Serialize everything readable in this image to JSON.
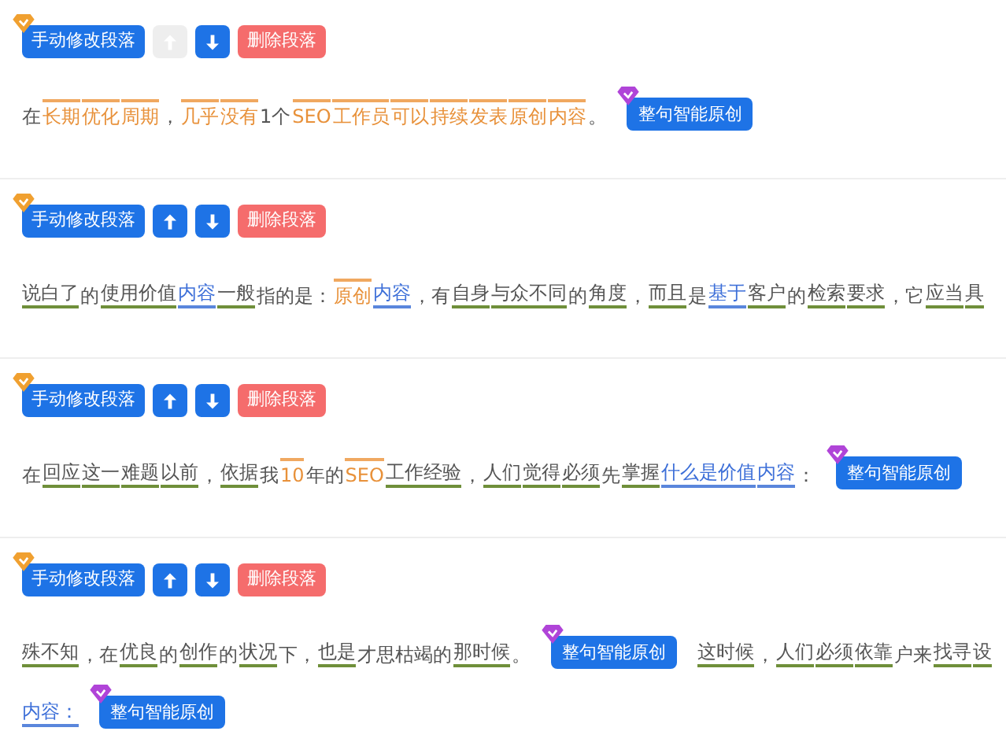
{
  "paragraphs": [
    {
      "toolbar": {
        "edit_label": "手动修改段落",
        "up": {
          "disabled": true
        },
        "down": {
          "disabled": false
        },
        "delete_label": "删除段落"
      },
      "lines": [
        [
          {
            "kind": "plain",
            "text": "在"
          },
          {
            "kind": "original",
            "text": "长期"
          },
          {
            "kind": "original",
            "text": "优化"
          },
          {
            "kind": "original",
            "text": "周期"
          },
          {
            "kind": "plain",
            "text": "，"
          },
          {
            "kind": "original",
            "text": "几乎"
          },
          {
            "kind": "original",
            "text": "没有"
          },
          {
            "kind": "plain",
            "text": "1个"
          },
          {
            "kind": "original",
            "text": "SEO"
          },
          {
            "kind": "original",
            "text": "工作员"
          },
          {
            "kind": "original",
            "text": "可以"
          },
          {
            "kind": "original",
            "text": "持续"
          },
          {
            "kind": "original",
            "text": "发表"
          },
          {
            "kind": "original",
            "text": "原创"
          },
          {
            "kind": "original",
            "text": "内容"
          },
          {
            "kind": "plain",
            "text": "。"
          },
          {
            "kind": "button",
            "text": "整句智能原创"
          }
        ]
      ]
    },
    {
      "toolbar": {
        "edit_label": "手动修改段落",
        "up": {
          "disabled": false
        },
        "down": {
          "disabled": false
        },
        "delete_label": "删除段落"
      },
      "lines": [
        [
          {
            "kind": "keyword",
            "text": "说白了"
          },
          {
            "kind": "plain",
            "text": "的"
          },
          {
            "kind": "keyword",
            "text": "使用价值"
          },
          {
            "kind": "synonym",
            "text": "内容"
          },
          {
            "kind": "keyword",
            "text": "一般"
          },
          {
            "kind": "plain",
            "text": "指的是："
          },
          {
            "kind": "original",
            "text": "原创"
          },
          {
            "kind": "synonym",
            "text": "内容"
          },
          {
            "kind": "plain",
            "text": "，有"
          },
          {
            "kind": "keyword",
            "text": "自身"
          },
          {
            "kind": "keyword",
            "text": "与众不同"
          },
          {
            "kind": "plain",
            "text": "的"
          },
          {
            "kind": "keyword",
            "text": "角度"
          },
          {
            "kind": "plain",
            "text": "，"
          },
          {
            "kind": "keyword",
            "text": "而且"
          },
          {
            "kind": "plain",
            "text": "是"
          },
          {
            "kind": "synonym",
            "text": "基于"
          },
          {
            "kind": "keyword",
            "text": "客户"
          },
          {
            "kind": "plain",
            "text": "的"
          },
          {
            "kind": "keyword",
            "text": "检索"
          },
          {
            "kind": "keyword",
            "text": "要求"
          },
          {
            "kind": "plain",
            "text": "，它"
          },
          {
            "kind": "keyword",
            "text": "应当"
          },
          {
            "kind": "keyword",
            "text": "具"
          }
        ]
      ]
    },
    {
      "toolbar": {
        "edit_label": "手动修改段落",
        "up": {
          "disabled": false
        },
        "down": {
          "disabled": false
        },
        "delete_label": "删除段落"
      },
      "lines": [
        [
          {
            "kind": "plain",
            "text": "在"
          },
          {
            "kind": "keyword",
            "text": "回应"
          },
          {
            "kind": "keyword",
            "text": "这一"
          },
          {
            "kind": "keyword",
            "text": "难题"
          },
          {
            "kind": "keyword",
            "text": "以前"
          },
          {
            "kind": "plain",
            "text": "，"
          },
          {
            "kind": "keyword",
            "text": "依据"
          },
          {
            "kind": "plain",
            "text": "我"
          },
          {
            "kind": "original",
            "text": "10"
          },
          {
            "kind": "plain",
            "text": "年的"
          },
          {
            "kind": "original",
            "text": "SEO"
          },
          {
            "kind": "keyword",
            "text": "工作经验"
          },
          {
            "kind": "plain",
            "text": "，"
          },
          {
            "kind": "keyword",
            "text": "人们"
          },
          {
            "kind": "keyword",
            "text": "觉得"
          },
          {
            "kind": "keyword",
            "text": "必须"
          },
          {
            "kind": "plain",
            "text": "先"
          },
          {
            "kind": "keyword",
            "text": "掌握"
          },
          {
            "kind": "synonym",
            "text": "什么是价值"
          },
          {
            "kind": "synonym",
            "text": "内容"
          },
          {
            "kind": "plain",
            "text": "："
          },
          {
            "kind": "button",
            "text": "整句智能原创"
          }
        ]
      ]
    },
    {
      "toolbar": {
        "edit_label": "手动修改段落",
        "up": {
          "disabled": false
        },
        "down": {
          "disabled": false
        },
        "delete_label": "删除段落"
      },
      "lines": [
        [
          {
            "kind": "keyword",
            "text": "殊不知"
          },
          {
            "kind": "plain",
            "text": "，在"
          },
          {
            "kind": "keyword",
            "text": "优良"
          },
          {
            "kind": "plain",
            "text": "的"
          },
          {
            "kind": "keyword",
            "text": "创作"
          },
          {
            "kind": "plain",
            "text": "的"
          },
          {
            "kind": "keyword",
            "text": "状况"
          },
          {
            "kind": "plain",
            "text": "下，"
          },
          {
            "kind": "keyword",
            "text": "也是"
          },
          {
            "kind": "plain",
            "text": "才思枯竭的"
          },
          {
            "kind": "keyword",
            "text": "那时候"
          },
          {
            "kind": "plain",
            "text": "。"
          },
          {
            "kind": "button",
            "text": "整句智能原创"
          },
          {
            "kind": "keyword",
            "text": "这时候"
          },
          {
            "kind": "plain",
            "text": "，"
          },
          {
            "kind": "keyword",
            "text": "人们"
          },
          {
            "kind": "keyword",
            "text": "必须"
          },
          {
            "kind": "keyword",
            "text": "依靠"
          },
          {
            "kind": "plain",
            "text": "户来"
          },
          {
            "kind": "keyword",
            "text": "找寻"
          },
          {
            "kind": "keyword",
            "text": "设"
          }
        ],
        [
          {
            "kind": "synonym",
            "text": "内容："
          },
          {
            "kind": "button",
            "text": "整句智能原创"
          }
        ]
      ]
    }
  ]
}
